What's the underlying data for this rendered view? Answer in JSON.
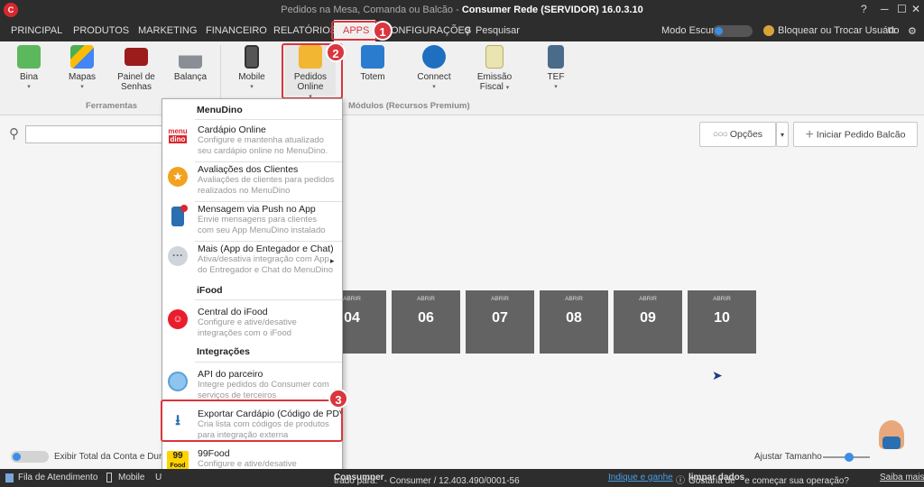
{
  "window": {
    "logo": "C",
    "title_prefix": "Pedidos na Mesa, Comanda ou Balcão - ",
    "title_main": "Consumer Rede (SERVIDOR) 16.0.3.10",
    "help": "?",
    "minimize": "─",
    "maximize": "☐",
    "close": "✕"
  },
  "menu": {
    "principal": "PRINCIPAL",
    "produtos": "PRODUTOS",
    "marketing": "MARKETING",
    "financeiro": "FINANCEIRO",
    "relatorios": "RELATÓRIOS",
    "apps": "APPS",
    "configuracoes": "CONFIGURAÇÕES",
    "pesquisar": "Pesquisar",
    "modo_escuro": "Modo Escuro",
    "bloquear": "Bloquear ou Trocar Usuário"
  },
  "ribbon": {
    "bina": "Bina",
    "mapas": "Mapas",
    "painel1": "Painel de",
    "painel2": "Senhas",
    "balanca": "Balança",
    "mobile": "Mobile",
    "pedidos1": "Pedidos",
    "pedidos2": "Online",
    "totem": "Totem",
    "connect": "Connect",
    "emissao1": "Emissão",
    "emissao2": "Fiscal",
    "tef": "TEF",
    "group_ferramentas": "Ferramentas",
    "group_modulos": "Módulos (Recursos Premium)"
  },
  "badges": {
    "b1": "1",
    "b2": "2",
    "b3": "3"
  },
  "toolbar": {
    "opcoes": "Opções",
    "iniciar": "Iniciar Pedido Balcão",
    "plus": "+",
    "dots": "○○○"
  },
  "tables": [
    {
      "label": "ABRIR",
      "number": "04"
    },
    {
      "label": "ABRIR",
      "number": "06"
    },
    {
      "label": "ABRIR",
      "number": "07"
    },
    {
      "label": "ABRIR",
      "number": "08"
    },
    {
      "label": "ABRIR",
      "number": "09"
    },
    {
      "label": "ABRIR",
      "number": "10"
    }
  ],
  "dropdown": {
    "h_menudino": "MenuDino",
    "h_ifood": "iFood",
    "h_integracoes": "Integrações",
    "cardapio_t": "Cardápio Online",
    "cardapio_d": "Configure e mantenha atualizado seu cardápio online no MenuDino.",
    "cardapio_logo1": "menu",
    "cardapio_logo2": "dino",
    "avaliacoes_t": "Avaliações dos Clientes",
    "avaliacoes_d": "Avaliações de clientes para pedidos realizados no MenuDino",
    "push_t": "Mensagem via Push no App",
    "push_d": "Envie mensagens para clientes com seu App MenuDino instalado",
    "mais_t": "Mais (App do Entegador e Chat)",
    "mais_d": "Ativa/desativa integração com App do Entregador e Chat do MenuDino",
    "ifood_t": "Central do iFood",
    "ifood_d": "Configure e ative/desative integrações com o iFood",
    "api_t": "API do parceiro",
    "api_d": "Integre pedidos do Consumer com serviços de terceiros",
    "exportar_t": "Exportar Cardápio (Código de PDV)",
    "exportar_d": "Cria lista com códigos de produtos para integração externa",
    "food99_t": "99Food",
    "food99_d": "Configure e ative/desative integrações com a 99food",
    "food99_logo": "99",
    "food99_logo2": "Food",
    "arrow": "▸",
    "more": "▾"
  },
  "footer": {
    "exibir": "Exibir Total da Conta e Duração",
    "ajustar": "Ajustar Tamanho"
  },
  "status": {
    "fila": "Fila de Atendimento",
    "mobile": "Mobile",
    "u": "U",
    "registro": "trado para: ",
    "consumer": "Consumner",
    "cnpj": " - Consumer / 12.403.490/0001-56",
    "indique": "Indique e ganhe",
    "gostaria1": "Gostaria de ",
    "gostaria2": "limpar dados",
    "gostaria3": " e começar sua operação?",
    "saiba": "Saiba mais"
  },
  "colors": {
    "accent": "#d9363e",
    "tile": "#636363",
    "dark": "#2d2d2d"
  }
}
